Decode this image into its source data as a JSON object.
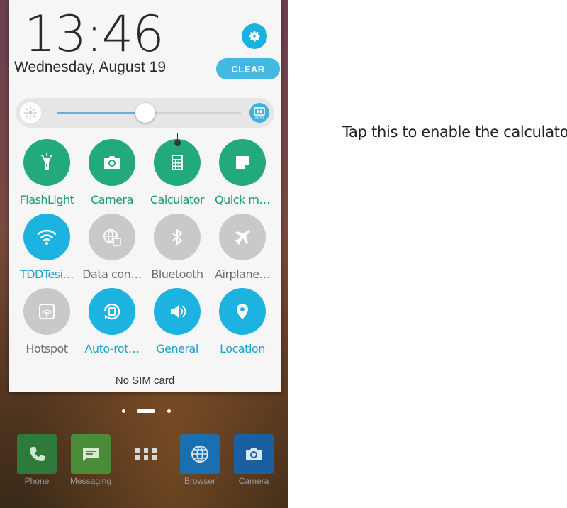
{
  "status": {
    "time": "13:46",
    "date": "Wednesday, August 19",
    "clear_label": "CLEAR"
  },
  "brightness": {
    "level": 0.48,
    "auto_label": "AUTO"
  },
  "quick_settings": [
    {
      "label": "FlashLight",
      "icon": "flashlight-icon",
      "state": "on",
      "color": "#23aa7a"
    },
    {
      "label": "Camera",
      "icon": "camera-icon",
      "state": "on",
      "color": "#23aa7a"
    },
    {
      "label": "Calculator",
      "icon": "calculator-icon",
      "state": "on",
      "color": "#23aa7a"
    },
    {
      "label": "Quick m…",
      "icon": "quick-memo-icon",
      "state": "on",
      "color": "#23aa7a"
    },
    {
      "label": "TDDTesi…",
      "icon": "wifi-icon",
      "state": "on",
      "color": "#1cb3e0"
    },
    {
      "label": "Data con…",
      "icon": "data-connection-icon",
      "state": "off",
      "color": "#c9c9c9"
    },
    {
      "label": "Bluetooth",
      "icon": "bluetooth-icon",
      "state": "off",
      "color": "#c9c9c9"
    },
    {
      "label": "Airplane…",
      "icon": "airplane-icon",
      "state": "off",
      "color": "#c9c9c9"
    },
    {
      "label": "Hotspot",
      "icon": "hotspot-icon",
      "state": "off",
      "color": "#c9c9c9"
    },
    {
      "label": "Auto-rot…",
      "icon": "auto-rotate-icon",
      "state": "on",
      "color": "#1cb3e0"
    },
    {
      "label": "General",
      "icon": "sound-icon",
      "state": "on",
      "color": "#1cb3e0"
    },
    {
      "label": "Location",
      "icon": "location-icon",
      "state": "on",
      "color": "#1cb3e0"
    }
  ],
  "sim_status": "No SIM card",
  "dock": [
    {
      "label": "Phone",
      "icon": "phone-icon",
      "color": "#2e7a3a"
    },
    {
      "label": "Messaging",
      "icon": "messaging-icon",
      "color": "#4a8c3a"
    },
    {
      "label": "",
      "icon": "app-drawer-icon",
      "color": ""
    },
    {
      "label": "Browser",
      "icon": "browser-icon",
      "color": "#1a6fb0"
    },
    {
      "label": "Camera",
      "icon": "camera-app-icon",
      "color": "#1a5fa0"
    }
  ],
  "annotation": {
    "text": "Tap this to enable the calculator"
  }
}
